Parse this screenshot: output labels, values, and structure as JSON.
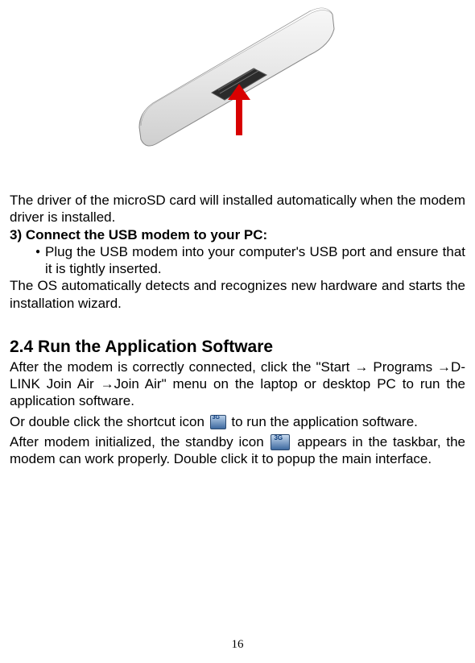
{
  "para1": "The driver of the microSD card will installed automatically when the modem driver is installed.",
  "step3_heading": "3) Connect the USB modem to your PC:",
  "bullet1": "Plug the USB modem into your computer's USB port and ensure that it is tightly inserted.",
  "para2": "The OS automatically detects and recognizes new hardware and starts the installation wizard.",
  "section_heading": "2.4 Run the Application Software",
  "para3": "After the modem is correctly connected, click the \"Start → Programs →D-LINK Join Air →Join Air\" menu on the laptop or desktop PC to run the application software.",
  "para4a": "Or double click the shortcut icon ",
  "para4b": " to run the application software.",
  "para5a": "After modem initialized, the standby icon ",
  "para5b": " appears in the taskbar, the modem can work properly. Double click it to popup the main interface.",
  "page_number": "16"
}
